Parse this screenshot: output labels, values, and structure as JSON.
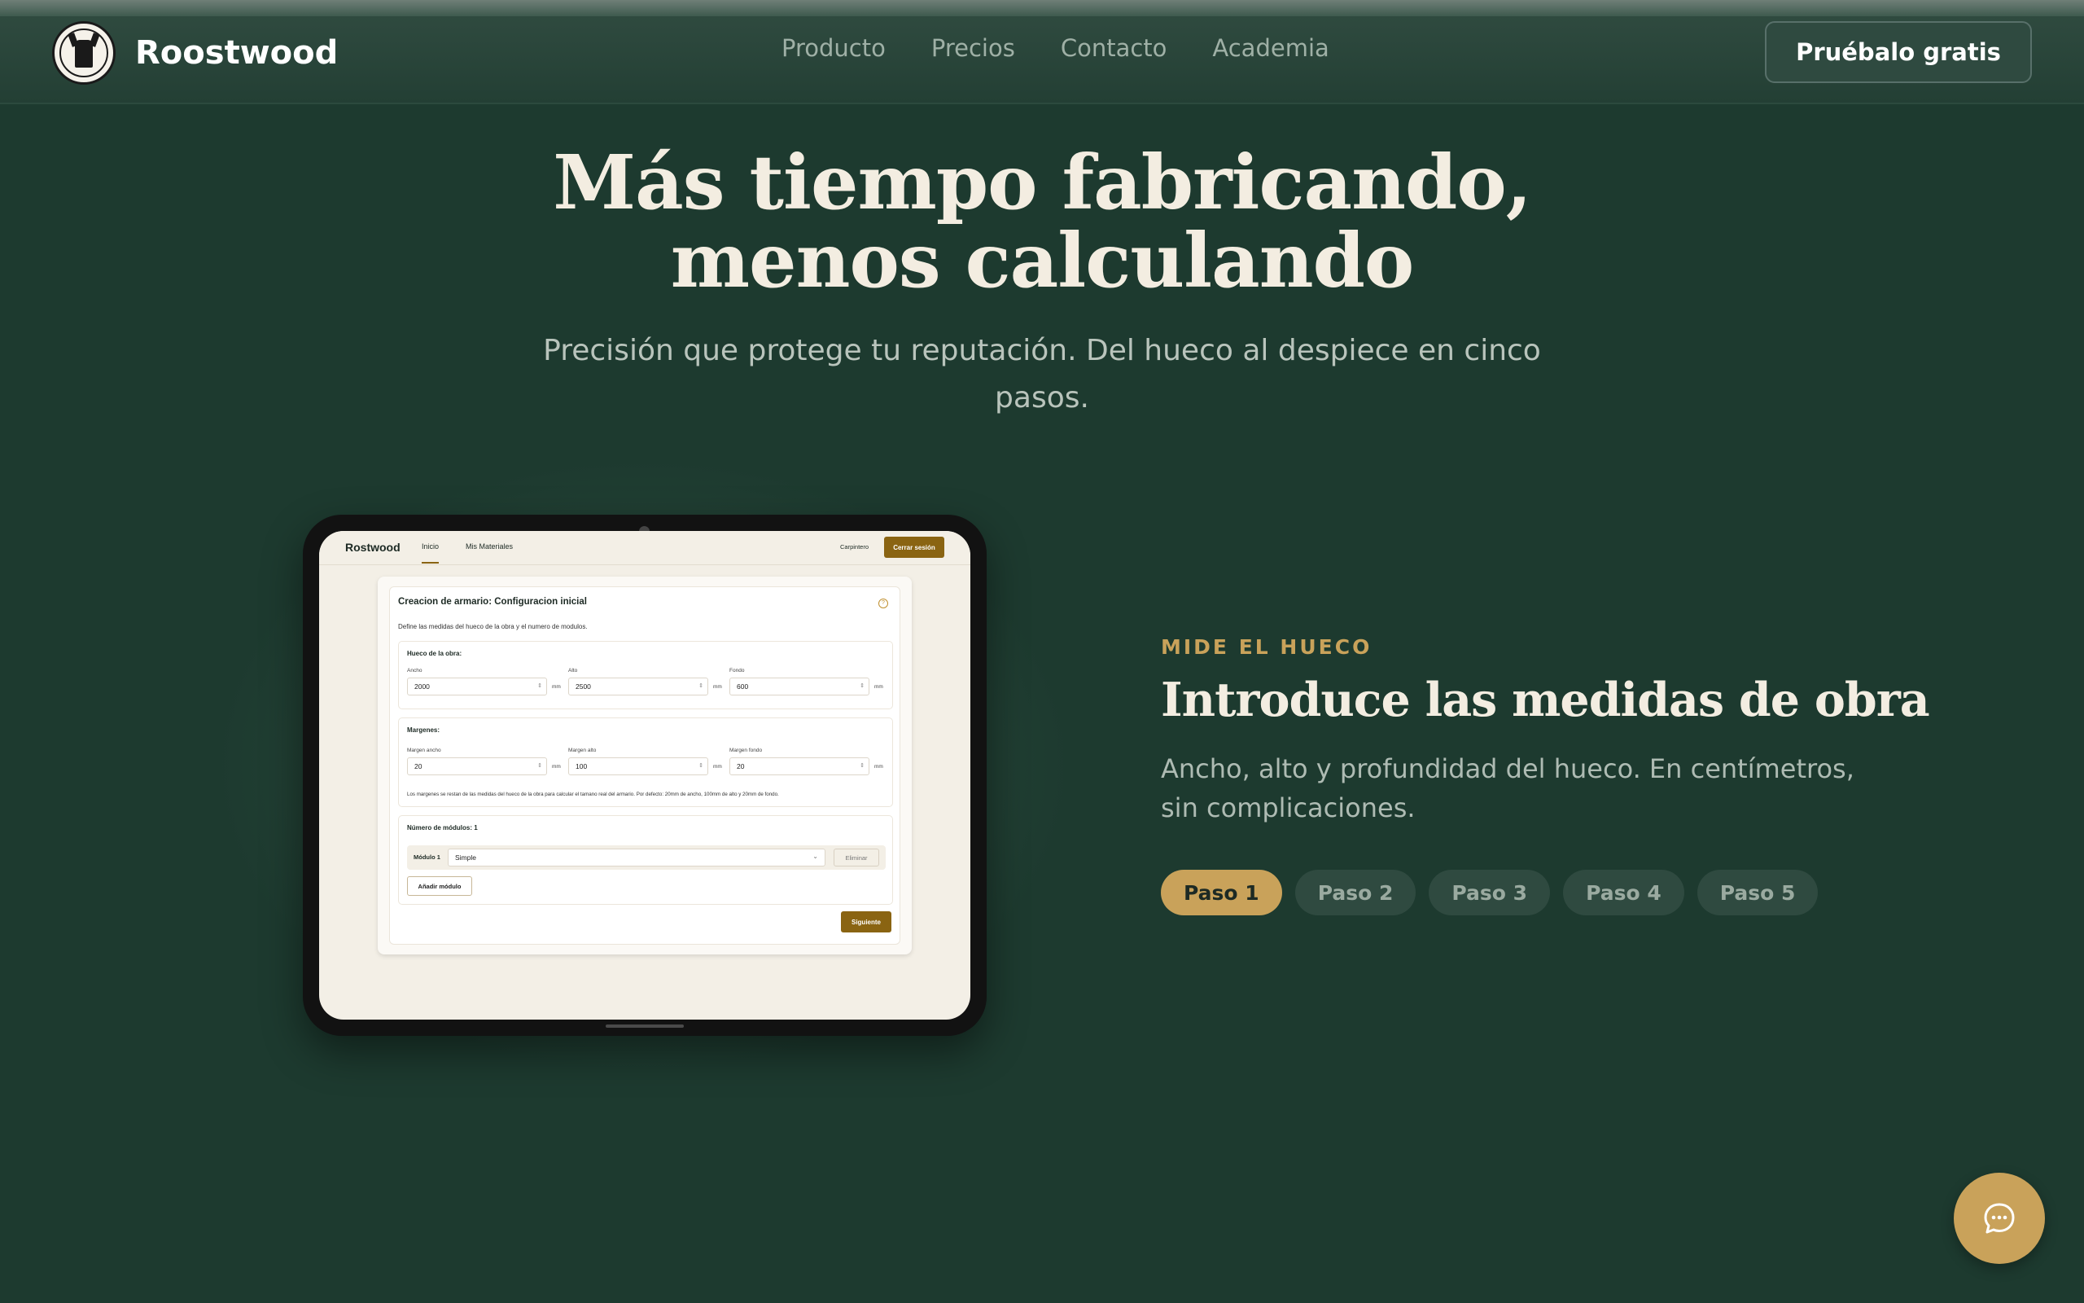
{
  "brand": {
    "name": "Roostwood",
    "logo_text": "ROOSTWOOD"
  },
  "nav": {
    "links": [
      "Producto",
      "Precios",
      "Contacto",
      "Academia"
    ]
  },
  "cta": {
    "label": "Pruébalo gratis"
  },
  "hero": {
    "title_line1": "Más tiempo fabricando,",
    "title_line2": "menos calculando",
    "subtitle": "Precisión que protege tu reputación. Del hueco al despiece en cinco pasos."
  },
  "app_preview": {
    "logo": "Rostwood",
    "tabs": [
      "Inicio",
      "Mis Materiales"
    ],
    "user": "Carpintero",
    "logout": "Cerrar sesión",
    "card_title": "Creacion de armario: Configuracion inicial",
    "card_desc": "Define las medidas del hueco de la obra y el numero de modulos.",
    "hueco": {
      "title": "Hueco de la obra:",
      "fields": [
        {
          "label": "Ancho",
          "value": "2000",
          "unit": "mm"
        },
        {
          "label": "Alto",
          "value": "2500",
          "unit": "mm"
        },
        {
          "label": "Fondo",
          "value": "600",
          "unit": "mm"
        }
      ]
    },
    "margenes": {
      "title": "Margenes:",
      "fields": [
        {
          "label": "Margen ancho",
          "value": "20",
          "unit": "mm"
        },
        {
          "label": "Margen alto",
          "value": "100",
          "unit": "mm"
        },
        {
          "label": "Margen fondo",
          "value": "20",
          "unit": "mm"
        }
      ],
      "note": "Los margenes se restan de las medidas del hueco de la obra para calcular el tamano real del armario. Por defecto: 20mm de ancho, 100mm de alto y 20mm de fondo."
    },
    "modulos": {
      "title": "Número de módulos: 1",
      "module_label": "Módulo 1",
      "module_value": "Simple",
      "delete_label": "Eliminar",
      "add_label": "Añadir módulo"
    },
    "next_label": "Siguiente"
  },
  "step": {
    "eyebrow": "MIDE EL HUECO",
    "title": "Introduce las medidas de obra",
    "description": "Ancho, alto y profundidad del hueco. En centímetros, sin complicaciones.",
    "pills": [
      "Paso 1",
      "Paso 2",
      "Paso 3",
      "Paso 4",
      "Paso 5"
    ],
    "active_index": 0
  },
  "colors": {
    "background": "#1d3a2f",
    "accent": "#c9a25a",
    "app_accent": "#8a6412"
  },
  "icons": {
    "chat": "chat-bubble-icon",
    "help": "question-circle-icon",
    "spinner": "up-down-spinner-icon",
    "chevron": "chevron-down-icon"
  }
}
